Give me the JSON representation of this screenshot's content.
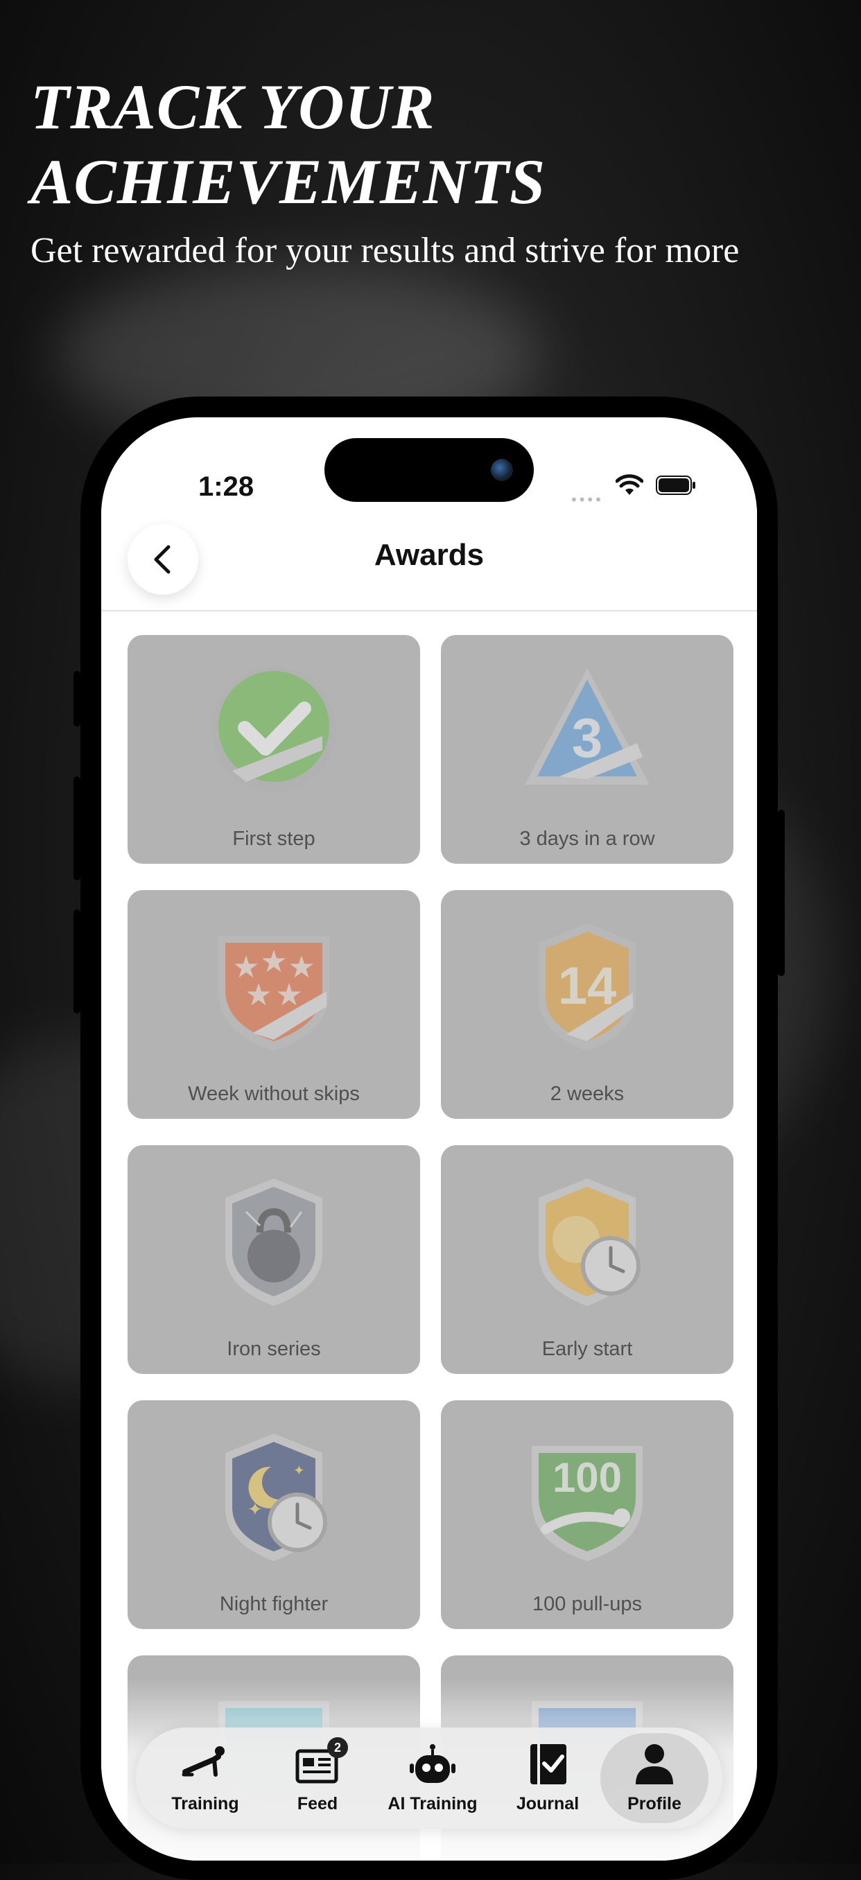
{
  "promo": {
    "headline_line1": "TRACK YOUR",
    "headline_line2": "ACHIEVEMENTS",
    "subline": "Get rewarded for your results and strive for more"
  },
  "status_bar": {
    "time": "1:28",
    "signal_dots": "••••"
  },
  "nav": {
    "title": "Awards"
  },
  "awards": [
    {
      "label": "First step",
      "icon": "green-check-badge-icon",
      "color": "#6cbf4a"
    },
    {
      "label": "3 days in a row",
      "icon": "triangle-3-badge-icon",
      "color": "#5c9ee0"
    },
    {
      "label": "Week without skips",
      "icon": "five-stars-shield-icon",
      "color": "#e86a3a"
    },
    {
      "label": "2 weeks",
      "icon": "number-14-shield-icon",
      "color": "#e8a43a"
    },
    {
      "label": "Iron series",
      "icon": "kettlebell-shield-icon",
      "color": "#8a8f99"
    },
    {
      "label": "Early start",
      "icon": "sunrise-clock-shield-icon",
      "color": "#f0b23a"
    },
    {
      "label": "Night fighter",
      "icon": "moon-clock-shield-icon",
      "color": "#3b4a7a"
    },
    {
      "label": "100 pull-ups",
      "icon": "number-100-shield-icon",
      "color": "#5aa84a"
    },
    {
      "label": "",
      "icon": "cyan-badge-icon",
      "color": "#4fb5c9"
    },
    {
      "label": "",
      "icon": "blue-badge-icon",
      "color": "#3a78c9"
    }
  ],
  "tabbar": {
    "items": [
      {
        "label": "Training",
        "icon": "pushup-icon"
      },
      {
        "label": "Feed",
        "icon": "news-icon",
        "badge": "2"
      },
      {
        "label": "AI Training",
        "icon": "robot-icon"
      },
      {
        "label": "Journal",
        "icon": "journal-check-icon"
      },
      {
        "label": "Profile",
        "icon": "person-icon",
        "active": true
      }
    ]
  }
}
